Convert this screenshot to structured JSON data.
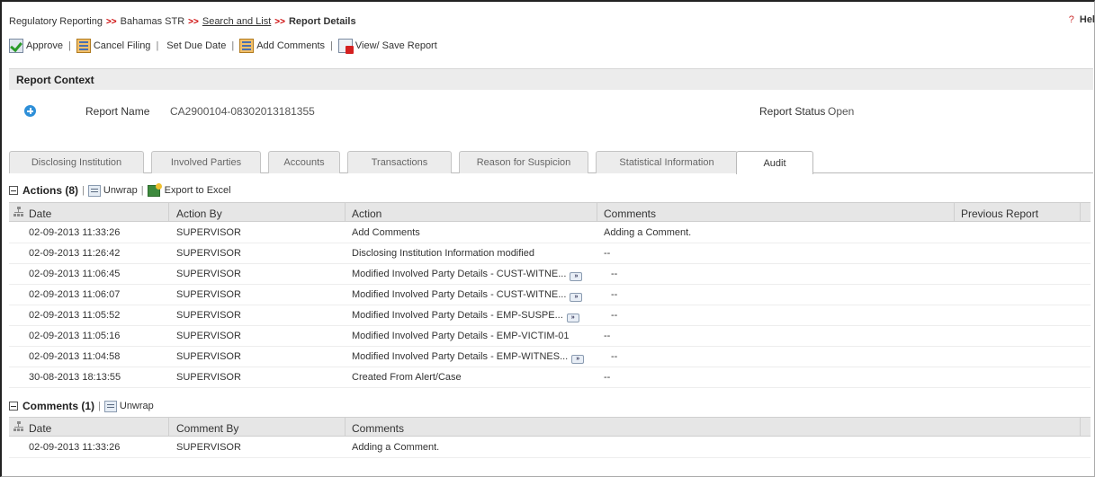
{
  "breadcrumb": {
    "items": [
      "Regulatory Reporting",
      "Bahamas STR",
      "Search and List",
      "Report Details"
    ],
    "separator": ">>"
  },
  "help": {
    "icon": "?",
    "label": "Hel"
  },
  "toolbar": {
    "approve": "Approve",
    "cancel_filing": "Cancel Filing",
    "set_due_date": "Set Due Date",
    "add_comments": "Add Comments",
    "view_save_report": "View/ Save Report",
    "separator": "|"
  },
  "report_context": {
    "title": "Report Context",
    "report_name_label": "Report Name",
    "report_name_value": "CA2900104-08302013181355",
    "report_status_label": "Report Status",
    "report_status_value": "Open"
  },
  "tabs": [
    {
      "label": "Disclosing Institution"
    },
    {
      "label": "Involved Parties"
    },
    {
      "label": "Accounts"
    },
    {
      "label": "Transactions"
    },
    {
      "label": "Reason for Suspicion"
    },
    {
      "label": "Statistical Information"
    },
    {
      "label": "Audit",
      "active": true
    }
  ],
  "actions_section": {
    "title": "Actions (8)",
    "unwrap": "Unwrap",
    "export": "Export to Excel",
    "columns": [
      "Date",
      "Action By",
      "Action",
      "Comments",
      "Previous Report"
    ],
    "more_glyph": "»",
    "rows": [
      {
        "date": "02-09-2013 11:33:26",
        "by": "SUPERVISOR",
        "action": "Add Comments",
        "comments": "Adding a Comment.",
        "more": false
      },
      {
        "date": "02-09-2013 11:26:42",
        "by": "SUPERVISOR",
        "action": "Disclosing Institution Information modified",
        "comments": "--",
        "more": false
      },
      {
        "date": "02-09-2013 11:06:45",
        "by": "SUPERVISOR",
        "action": "Modified Involved Party Details - CUST-WITNE...",
        "comments": "--",
        "more": true
      },
      {
        "date": "02-09-2013 11:06:07",
        "by": "SUPERVISOR",
        "action": "Modified Involved Party Details - CUST-WITNE...",
        "comments": "--",
        "more": true
      },
      {
        "date": "02-09-2013 11:05:52",
        "by": "SUPERVISOR",
        "action": "Modified Involved Party Details - EMP-SUSPE...",
        "comments": "--",
        "more": true
      },
      {
        "date": "02-09-2013 11:05:16",
        "by": "SUPERVISOR",
        "action": "Modified Involved Party Details - EMP-VICTIM-01",
        "comments": "--",
        "more": false
      },
      {
        "date": "02-09-2013 11:04:58",
        "by": "SUPERVISOR",
        "action": "Modified Involved Party Details - EMP-WITNES...",
        "comments": "--",
        "more": true
      },
      {
        "date": "30-08-2013 18:13:55",
        "by": "SUPERVISOR",
        "action": "Created From Alert/Case",
        "comments": "--",
        "more": false
      }
    ]
  },
  "comments_section": {
    "title": "Comments (1)",
    "unwrap": "Unwrap",
    "columns": [
      "Date",
      "Comment By",
      "Comments"
    ],
    "rows": [
      {
        "date": "02-09-2013 11:33:26",
        "by": "SUPERVISOR",
        "comment": "Adding a Comment."
      }
    ]
  },
  "colors": {
    "accent_red": "#cc0000",
    "info_blue": "#2e8fd8",
    "header_gray": "#ececec"
  }
}
